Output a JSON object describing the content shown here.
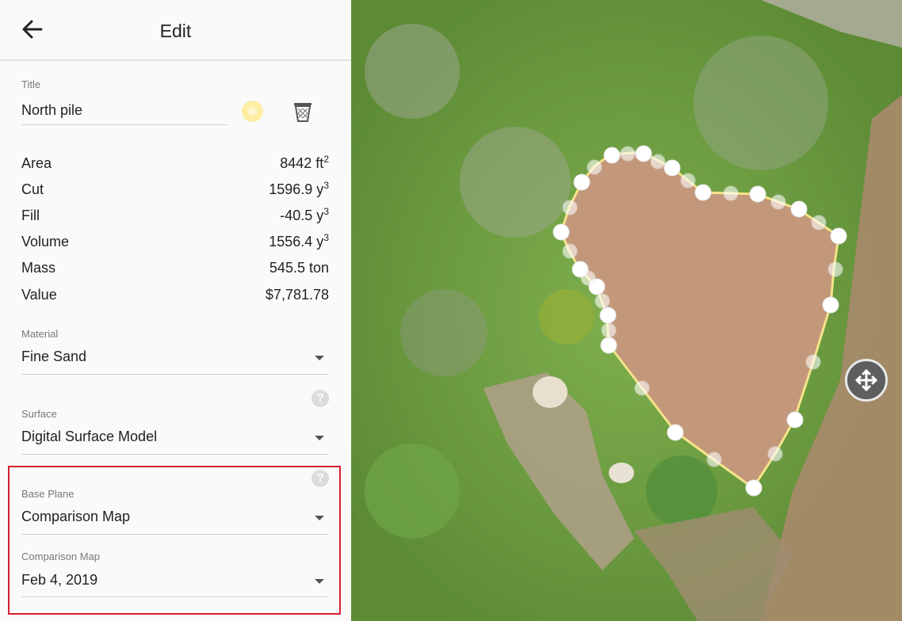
{
  "header": {
    "title": "Edit",
    "back_icon": "arrow-left-icon"
  },
  "title_field": {
    "label": "Title",
    "value": "North pile"
  },
  "icons": {
    "favorite": "star-icon",
    "delete": "trash-icon",
    "help": "question-icon",
    "move": "move-arrows-icon"
  },
  "stats": [
    {
      "name": "Area",
      "value": "8442 ft",
      "unit_exp": "2"
    },
    {
      "name": "Cut",
      "value": "1596.9 y",
      "unit_exp": "3"
    },
    {
      "name": "Fill",
      "value": "-40.5 y",
      "unit_exp": "3"
    },
    {
      "name": "Volume",
      "value": "1556.4 y",
      "unit_exp": "3"
    },
    {
      "name": "Mass",
      "value": "545.5 ton",
      "unit_exp": ""
    },
    {
      "name": "Value",
      "value": "$7,781.78",
      "unit_exp": ""
    }
  ],
  "material": {
    "label": "Material",
    "value": "Fine Sand"
  },
  "surface": {
    "label": "Surface",
    "value": "Digital Surface Model"
  },
  "base_plane": {
    "label": "Base Plane",
    "value": "Comparison Map"
  },
  "comparison_map": {
    "label": "Comparison Map",
    "value": "Feb 4, 2019"
  },
  "colors": {
    "highlight": "#d81f2e",
    "polygon_line": "#f4e48a",
    "vertex": "#ffffff"
  }
}
